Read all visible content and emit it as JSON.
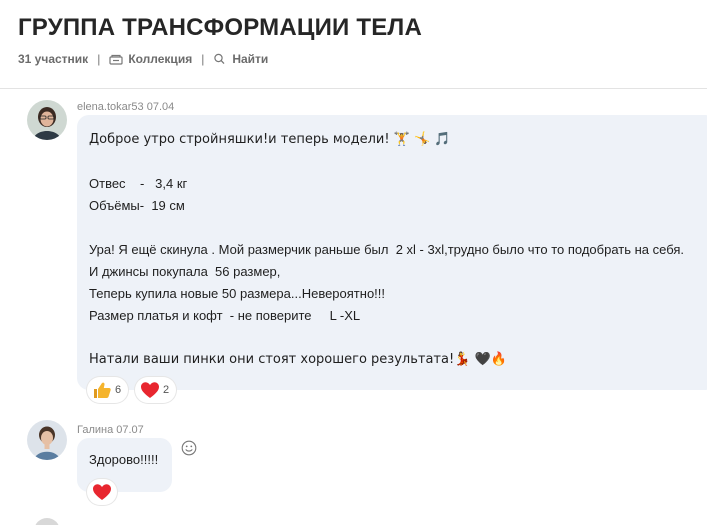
{
  "group": {
    "title": "ГРУППА ТРАНСФОРМАЦИИ ТЕЛА",
    "participants": "31 участник",
    "separator": "|",
    "collection_label": "Коллекция",
    "find_label": "Найти"
  },
  "messages": [
    {
      "author": "elena.tokar53 07.04",
      "lines": [
        "Доброе утро стройняшки!и теперь модели! 🏋 🤸 🎵",
        "",
        "Отвес    -   3,4 кг",
        "Объёмы-  19 см",
        "",
        "Ура! Я ещё скинула . Мой размерчик раньше был  2 xl - 3xl,трудно было что то подобрать на себя.",
        "И джинсы покупала  56 размер,",
        "Теперь купила новые 50 размера...Невероятно!!!",
        "Размер платья и кофт  - не поверите     L -XL",
        "",
        "Натали ваши пинки они стоят хорошего результата!💃 🖤🔥"
      ],
      "reactions": [
        {
          "icon": "thumbs-up-icon",
          "count": "6"
        },
        {
          "icon": "heart-icon",
          "count": "2"
        }
      ]
    },
    {
      "author": "Галина 07.07",
      "lines": [
        "Здорово!!!!!"
      ],
      "reactions": [
        {
          "icon": "heart-icon",
          "count": ""
        }
      ]
    }
  ],
  "colors": {
    "bubble": "#eef2f8",
    "heart": "#e8262f",
    "thumb": "#f5b42d",
    "meta_text": "#6b6b6b"
  }
}
